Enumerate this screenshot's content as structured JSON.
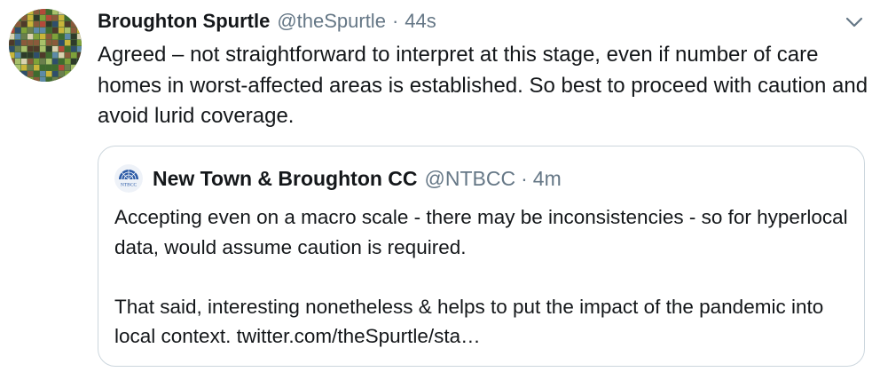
{
  "tweet": {
    "author_name": "Broughton Spurtle",
    "author_handle": "@theSpurtle",
    "separator": "·",
    "timestamp": "44s",
    "text": "Agreed – not straightforward to interpret at this stage, even if number of care homes in worst-affected areas is established. So best to proceed with caution and avoid lurid coverage.",
    "avatar_icon": "mosaic-avatar",
    "menu_icon": "chevron-down-icon"
  },
  "quoted_tweet": {
    "author_name": "New Town & Broughton CC",
    "author_handle": "@NTBCC",
    "separator": "·",
    "timestamp": "4m",
    "paragraph_1": "Accepting even on a macro scale - there may be inconsistencies - so for hyperlocal data, would assume caution is required.",
    "paragraph_2": "That said, interesting nonetheless & helps to put the impact of the pandemic into local context. twitter.com/theSpurtle/sta…",
    "avatar_logo_text": "NTBCC"
  },
  "colors": {
    "text_primary": "#14171a",
    "text_secondary": "#657786",
    "border": "#ccd6dd",
    "ntbcc_blue": "#2b5aa6"
  }
}
